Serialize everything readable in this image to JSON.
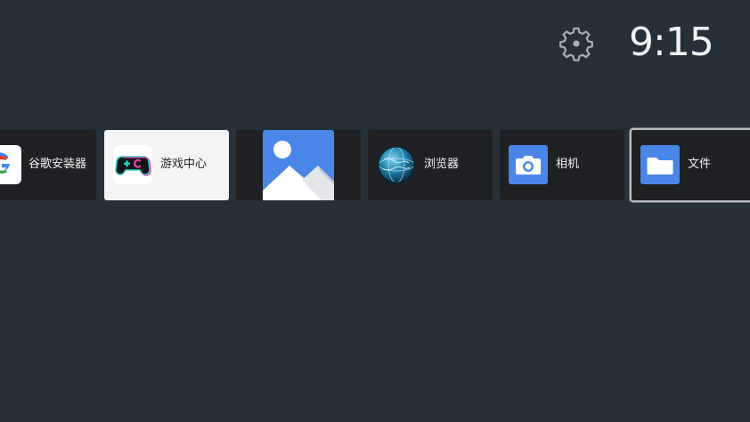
{
  "status_bar": {
    "settings_icon": "gear-icon",
    "time": "9:15"
  },
  "apps": [
    {
      "label": "谷歌安装器",
      "icon": "google-g-icon"
    },
    {
      "label": "游戏中心",
      "icon": "gamepad-icon"
    },
    {
      "label": "",
      "icon": "image-landscape-icon"
    },
    {
      "label": "浏览器",
      "icon": "globe-icon"
    },
    {
      "label": "相机",
      "icon": "camera-icon"
    },
    {
      "label": "文件",
      "icon": "folder-icon"
    }
  ],
  "colors": {
    "background": "#263038",
    "tile": "#1f2125",
    "tile_selected_light": "#f4f4f4",
    "focus_border": "#b8bcc0",
    "accent_blue": "#4a86e8"
  }
}
